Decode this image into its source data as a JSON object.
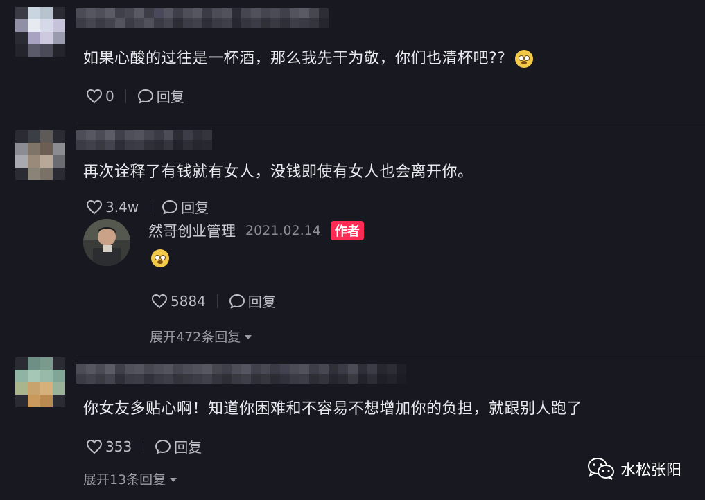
{
  "comments": [
    {
      "text": "如果心酸的过往是一杯酒，那么我先干为敬，你们也清杯吧??",
      "emoji": "dizzy-face-emoji",
      "likes": "0",
      "reply_label": "回复"
    },
    {
      "text": "再次诠释了有钱就有女人，没钱即使有女人也会离开你。",
      "likes": "3.4w",
      "reply_label": "回复",
      "reply": {
        "author": "然哥创业管理",
        "date": "2021.02.14",
        "badge": "作者",
        "emoji": "pleading-face-emoji",
        "likes": "5884",
        "reply_label": "回复"
      },
      "expand_label": "展开472条回复"
    },
    {
      "text": "你女友多贴心啊！知道你困难和不容易不想增加你的负担，就跟别人跑了",
      "likes": "353",
      "reply_label": "回复",
      "expand_label": "展开13条回复"
    }
  ],
  "watermark": {
    "text": "水松张阳",
    "icon": "wechat-icon"
  },
  "colors": {
    "background": "#171820",
    "badge": "#fe2c55",
    "text": "#e9eaee",
    "muted": "#9c9da4"
  }
}
